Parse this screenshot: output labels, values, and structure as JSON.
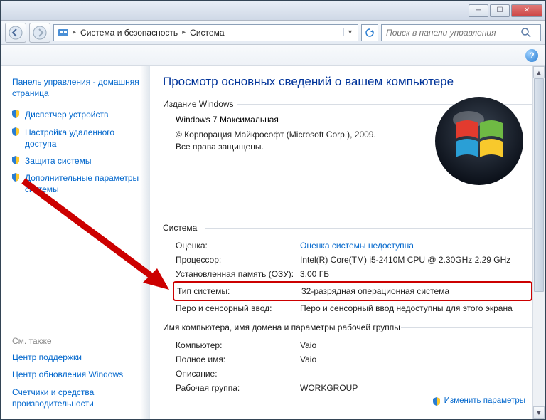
{
  "breadcrumbs": {
    "root": "Система и безопасность",
    "current": "Система"
  },
  "search": {
    "placeholder": "Поиск в панели управления"
  },
  "sidebar": {
    "home": "Панель управления - домашняя страница",
    "links": [
      "Диспетчер устройств",
      "Настройка удаленного доступа",
      "Защита системы",
      "Дополнительные параметры системы"
    ],
    "see_also_label": "См. также",
    "see_also": [
      "Центр поддержки",
      "Центр обновления Windows",
      "Счетчики и средства производительности"
    ]
  },
  "main": {
    "title": "Просмотр основных сведений о вашем компьютере",
    "edition_group": "Издание Windows",
    "edition_name": "Windows 7 Максимальная",
    "copyright": "© Корпорация Майкрософт (Microsoft Corp.), 2009. Все права защищены.",
    "system_group": "Система",
    "rows": {
      "rating_k": "Оценка:",
      "rating_v": "Оценка системы недоступна",
      "cpu_k": "Процессор:",
      "cpu_v": "Intel(R) Core(TM) i5-2410M CPU @ 2.30GHz   2.29 GHz",
      "ram_k": "Установленная память (ОЗУ):",
      "ram_v": "3,00 ГБ",
      "type_k": "Тип системы:",
      "type_v": "32-разрядная операционная система",
      "pen_k": "Перо и сенсорный ввод:",
      "pen_v": "Перо и сенсорный ввод недоступны для этого экрана"
    },
    "net_group": "Имя компьютера, имя домена и параметры рабочей группы",
    "net": {
      "comp_k": "Компьютер:",
      "comp_v": "Vaio",
      "full_k": "Полное имя:",
      "full_v": "Vaio",
      "desc_k": "Описание:",
      "desc_v": "",
      "wg_k": "Рабочая группа:",
      "wg_v": "WORKGROUP"
    },
    "change_link": "Изменить параметры"
  }
}
